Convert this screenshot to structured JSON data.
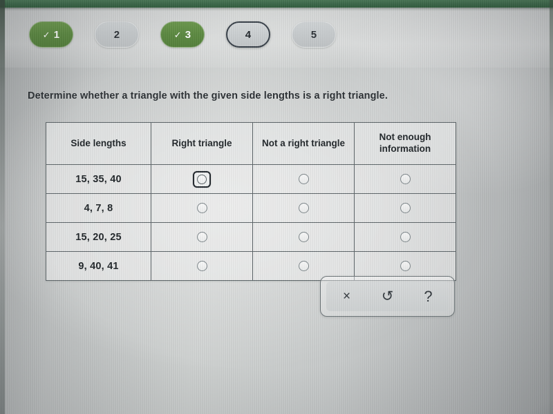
{
  "app": {
    "accent_green": "#3c6a4a",
    "pill_done_green": "#5d8b42",
    "pill_todo_gray": "#c7cbcd",
    "current_outline": "#39414a"
  },
  "steps": {
    "items": [
      {
        "number": "1",
        "state": "done",
        "check": "✓"
      },
      {
        "number": "2",
        "state": "todo",
        "check": ""
      },
      {
        "number": "3",
        "state": "done",
        "check": "✓"
      },
      {
        "number": "4",
        "state": "current",
        "check": ""
      },
      {
        "number": "5",
        "state": "todo",
        "check": ""
      }
    ]
  },
  "prompt": {
    "text": "Determine whether a triangle with the given side lengths is a right triangle."
  },
  "table": {
    "headers": [
      "Side lengths",
      "Right triangle",
      "Not a right triangle",
      "Not enough information"
    ],
    "rows": [
      {
        "side_lengths": "15, 35, 40",
        "selected": null,
        "focused_column": 1
      },
      {
        "side_lengths": "4, 7, 8",
        "selected": null,
        "focused_column": null
      },
      {
        "side_lengths": "15, 20, 25",
        "selected": null,
        "focused_column": null
      },
      {
        "side_lengths": "9, 40, 41",
        "selected": null,
        "focused_column": null
      }
    ]
  },
  "toolbar": {
    "buttons": [
      {
        "icon": "×",
        "name": "clear-icon"
      },
      {
        "icon": "↺",
        "name": "undo-icon"
      },
      {
        "icon": "?",
        "name": "help-icon"
      }
    ]
  }
}
